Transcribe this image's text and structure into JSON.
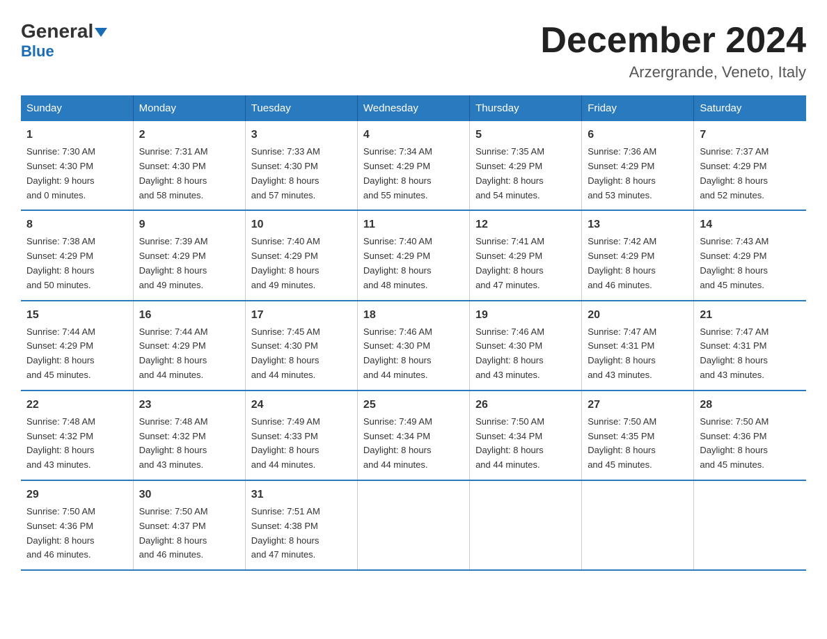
{
  "logo": {
    "general": "General",
    "blue": "Blue"
  },
  "title": "December 2024",
  "subtitle": "Arzergrande, Veneto, Italy",
  "weekdays": [
    "Sunday",
    "Monday",
    "Tuesday",
    "Wednesday",
    "Thursday",
    "Friday",
    "Saturday"
  ],
  "weeks": [
    [
      {
        "day": "1",
        "sunrise": "7:30 AM",
        "sunset": "4:30 PM",
        "daylight": "9 hours and 0 minutes."
      },
      {
        "day": "2",
        "sunrise": "7:31 AM",
        "sunset": "4:30 PM",
        "daylight": "8 hours and 58 minutes."
      },
      {
        "day": "3",
        "sunrise": "7:33 AM",
        "sunset": "4:30 PM",
        "daylight": "8 hours and 57 minutes."
      },
      {
        "day": "4",
        "sunrise": "7:34 AM",
        "sunset": "4:29 PM",
        "daylight": "8 hours and 55 minutes."
      },
      {
        "day": "5",
        "sunrise": "7:35 AM",
        "sunset": "4:29 PM",
        "daylight": "8 hours and 54 minutes."
      },
      {
        "day": "6",
        "sunrise": "7:36 AM",
        "sunset": "4:29 PM",
        "daylight": "8 hours and 53 minutes."
      },
      {
        "day": "7",
        "sunrise": "7:37 AM",
        "sunset": "4:29 PM",
        "daylight": "8 hours and 52 minutes."
      }
    ],
    [
      {
        "day": "8",
        "sunrise": "7:38 AM",
        "sunset": "4:29 PM",
        "daylight": "8 hours and 50 minutes."
      },
      {
        "day": "9",
        "sunrise": "7:39 AM",
        "sunset": "4:29 PM",
        "daylight": "8 hours and 49 minutes."
      },
      {
        "day": "10",
        "sunrise": "7:40 AM",
        "sunset": "4:29 PM",
        "daylight": "8 hours and 49 minutes."
      },
      {
        "day": "11",
        "sunrise": "7:40 AM",
        "sunset": "4:29 PM",
        "daylight": "8 hours and 48 minutes."
      },
      {
        "day": "12",
        "sunrise": "7:41 AM",
        "sunset": "4:29 PM",
        "daylight": "8 hours and 47 minutes."
      },
      {
        "day": "13",
        "sunrise": "7:42 AM",
        "sunset": "4:29 PM",
        "daylight": "8 hours and 46 minutes."
      },
      {
        "day": "14",
        "sunrise": "7:43 AM",
        "sunset": "4:29 PM",
        "daylight": "8 hours and 45 minutes."
      }
    ],
    [
      {
        "day": "15",
        "sunrise": "7:44 AM",
        "sunset": "4:29 PM",
        "daylight": "8 hours and 45 minutes."
      },
      {
        "day": "16",
        "sunrise": "7:44 AM",
        "sunset": "4:29 PM",
        "daylight": "8 hours and 44 minutes."
      },
      {
        "day": "17",
        "sunrise": "7:45 AM",
        "sunset": "4:30 PM",
        "daylight": "8 hours and 44 minutes."
      },
      {
        "day": "18",
        "sunrise": "7:46 AM",
        "sunset": "4:30 PM",
        "daylight": "8 hours and 44 minutes."
      },
      {
        "day": "19",
        "sunrise": "7:46 AM",
        "sunset": "4:30 PM",
        "daylight": "8 hours and 43 minutes."
      },
      {
        "day": "20",
        "sunrise": "7:47 AM",
        "sunset": "4:31 PM",
        "daylight": "8 hours and 43 minutes."
      },
      {
        "day": "21",
        "sunrise": "7:47 AM",
        "sunset": "4:31 PM",
        "daylight": "8 hours and 43 minutes."
      }
    ],
    [
      {
        "day": "22",
        "sunrise": "7:48 AM",
        "sunset": "4:32 PM",
        "daylight": "8 hours and 43 minutes."
      },
      {
        "day": "23",
        "sunrise": "7:48 AM",
        "sunset": "4:32 PM",
        "daylight": "8 hours and 43 minutes."
      },
      {
        "day": "24",
        "sunrise": "7:49 AM",
        "sunset": "4:33 PM",
        "daylight": "8 hours and 44 minutes."
      },
      {
        "day": "25",
        "sunrise": "7:49 AM",
        "sunset": "4:34 PM",
        "daylight": "8 hours and 44 minutes."
      },
      {
        "day": "26",
        "sunrise": "7:50 AM",
        "sunset": "4:34 PM",
        "daylight": "8 hours and 44 minutes."
      },
      {
        "day": "27",
        "sunrise": "7:50 AM",
        "sunset": "4:35 PM",
        "daylight": "8 hours and 45 minutes."
      },
      {
        "day": "28",
        "sunrise": "7:50 AM",
        "sunset": "4:36 PM",
        "daylight": "8 hours and 45 minutes."
      }
    ],
    [
      {
        "day": "29",
        "sunrise": "7:50 AM",
        "sunset": "4:36 PM",
        "daylight": "8 hours and 46 minutes."
      },
      {
        "day": "30",
        "sunrise": "7:50 AM",
        "sunset": "4:37 PM",
        "daylight": "8 hours and 46 minutes."
      },
      {
        "day": "31",
        "sunrise": "7:51 AM",
        "sunset": "4:38 PM",
        "daylight": "8 hours and 47 minutes."
      },
      null,
      null,
      null,
      null
    ]
  ],
  "labels": {
    "sunrise": "Sunrise:",
    "sunset": "Sunset:",
    "daylight": "Daylight:"
  }
}
